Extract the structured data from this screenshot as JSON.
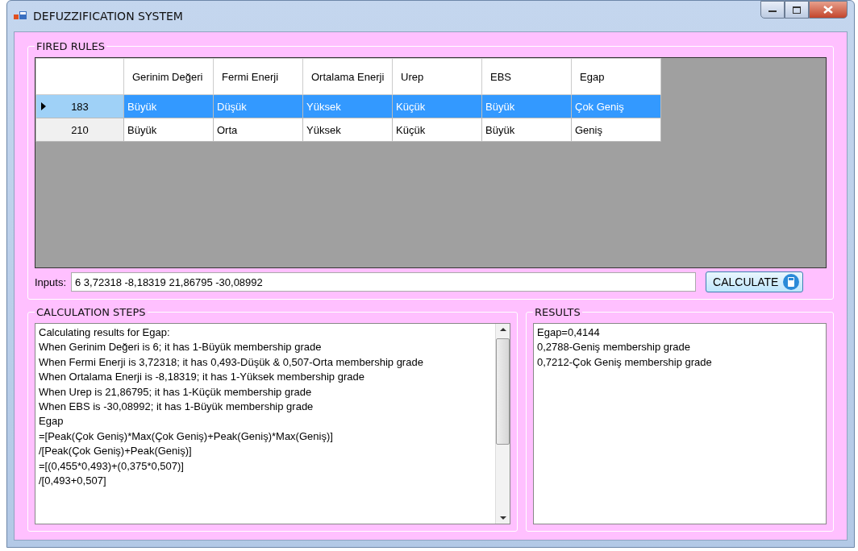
{
  "window": {
    "title": "DEFUZZIFICATION SYSTEM"
  },
  "fired_rules": {
    "title": "FIRED RULES",
    "columns": [
      "Gerinim Değeri",
      "Fermi Enerji",
      "Ortalama Enerji",
      "Urep",
      "EBS",
      "Egap"
    ],
    "rows": [
      {
        "id": "183",
        "selected": true,
        "cells": [
          "Büyük",
          "Düşük",
          "Yüksek",
          "Küçük",
          "Büyük",
          "Çok Geniş"
        ]
      },
      {
        "id": "210",
        "selected": false,
        "cells": [
          "Büyük",
          "Orta",
          "Yüksek",
          "Küçük",
          "Büyük",
          "Geniş"
        ]
      }
    ]
  },
  "inputs": {
    "label": "Inputs:",
    "value": "6 3,72318 -8,18319 21,86795 -30,08992"
  },
  "calculate_button": "CALCULATE",
  "calculation_steps": {
    "title": "CALCULATION STEPS",
    "lines": [
      "Calculating results for Egap:",
      "When Gerinim Değeri is 6; it has 1-Büyük membership grade",
      "When Fermi Enerji is 3,72318; it has 0,493-Düşük & 0,507-Orta membership grade",
      "When Ortalama Enerji is -8,18319; it has 1-Yüksek membership grade",
      "When Urep is 21,86795; it has 1-Küçük membership grade",
      "When EBS is -30,08992; it has 1-Büyük membership grade",
      "Egap",
      "=[Peak(Çok Geniş)*Max(Çok Geniş)+Peak(Geniş)*Max(Geniş)]",
      "/[Peak(Çok Geniş)+Peak(Geniş)]",
      "=[(0,455*0,493)+(0,375*0,507)]",
      "/[0,493+0,507]"
    ]
  },
  "results": {
    "title": "RESULTS",
    "lines": [
      "Egap=0,4144",
      "0,2788-Geniş membership grade",
      "0,7212-Çok Geniş membership grade"
    ]
  }
}
